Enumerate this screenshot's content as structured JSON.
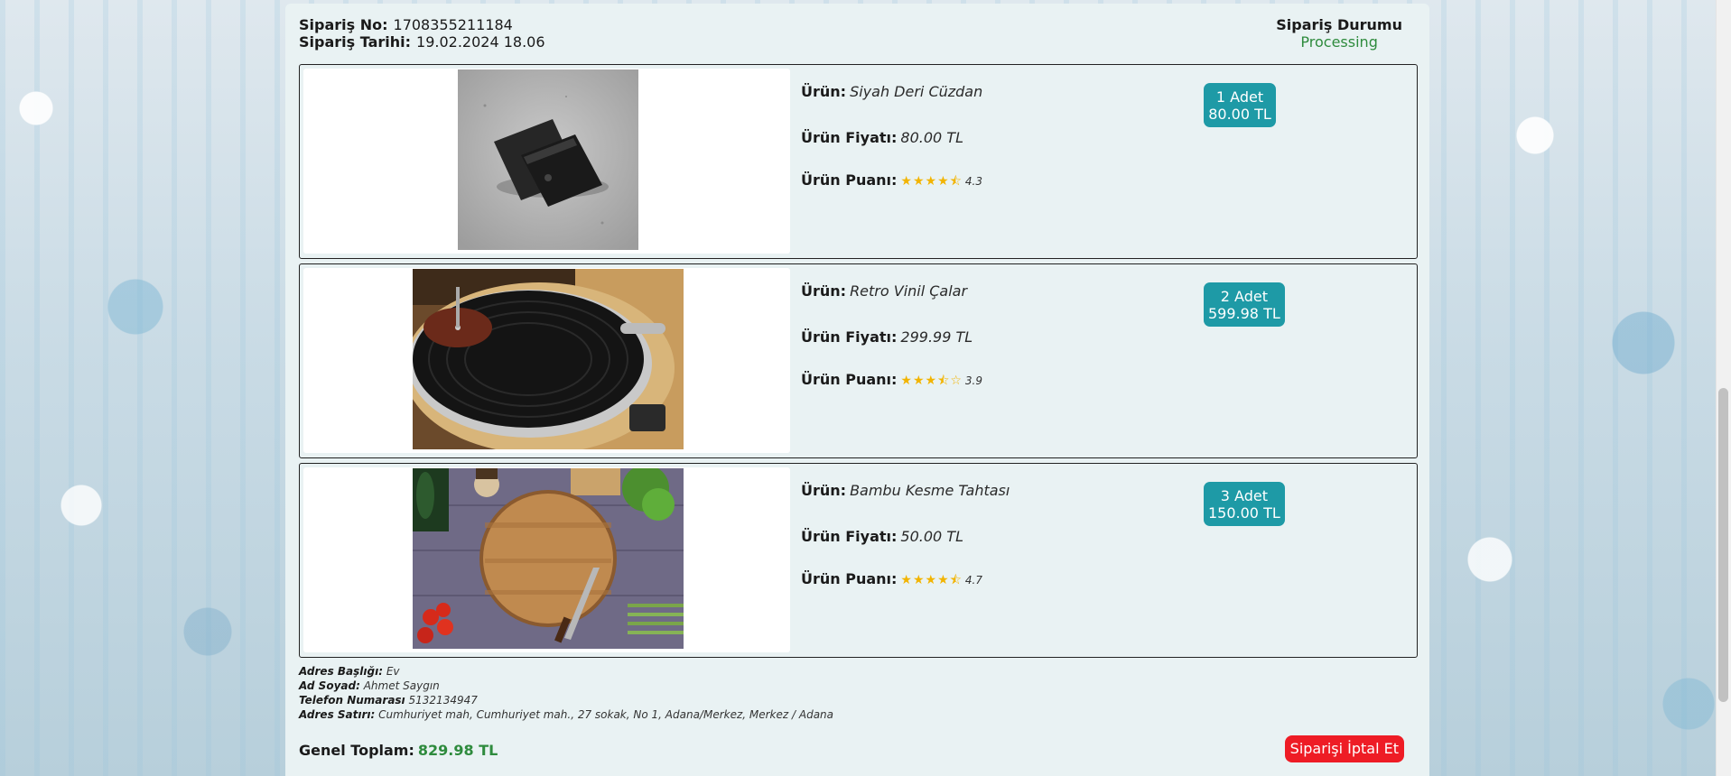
{
  "order": {
    "no_label": "Sipariş No:",
    "no_value": "1708355211184",
    "date_label": "Sipariş Tarihi:",
    "date_value": "19.02.2024 18.06",
    "status_label": "Sipariş Durumu",
    "status_value": "Processing"
  },
  "labels": {
    "product": "Ürün:",
    "price": "Ürün Fiyatı:",
    "rating": "Ürün Puanı:"
  },
  "items": [
    {
      "name": "Siyah Deri Cüzdan",
      "price": "80.00 TL",
      "stars": "★★★★⯪",
      "rating": "4.3",
      "qty": "1 Adet",
      "line_total": "80.00 TL",
      "image_icon": "wallet-image"
    },
    {
      "name": "Retro Vinil Çalar",
      "price": "299.99 TL",
      "stars": "★★★⯪☆",
      "rating": "3.9",
      "qty": "2 Adet",
      "line_total": "599.98 TL",
      "image_icon": "record-player-image"
    },
    {
      "name": "Bambu Kesme Tahtası",
      "price": "50.00 TL",
      "stars": "★★★★⯪",
      "rating": "4.7",
      "qty": "3 Adet",
      "line_total": "150.00 TL",
      "image_icon": "cutting-board-image"
    }
  ],
  "address": {
    "title_label": "Adres Başlığı:",
    "title_value": "Ev",
    "name_label": "Ad Soyad:",
    "name_value": "Ahmet Saygın",
    "phone_label": "Telefon Numarası",
    "phone_value": "5132134947",
    "line_label": "Adres Satırı:",
    "line_value": "Cumhuriyet mah, Cumhuriyet mah., 27 sokak, No 1, Adana/Merkez, Merkez / Adana"
  },
  "footer": {
    "total_label": "Genel Toplam:",
    "total_value": "829.98 TL",
    "cancel_label": "Siparişi İptal Et"
  },
  "colors": {
    "accent_teal": "#1e9aa6",
    "status_green": "#2e8b3d",
    "cancel_red": "#ee1c25",
    "star_gold": "#f2b400"
  }
}
